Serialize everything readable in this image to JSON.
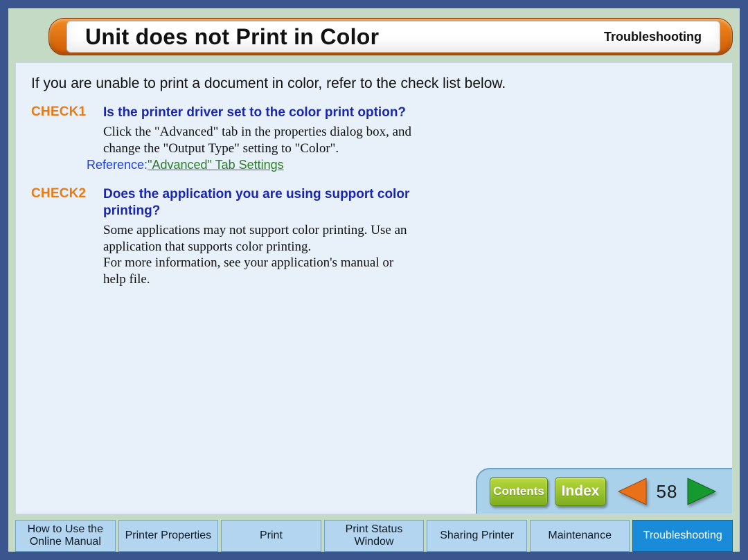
{
  "header": {
    "title": "Unit does not Print in Color",
    "section": "Troubleshooting"
  },
  "intro": "If you are unable to print a document in color, refer to the check list below.",
  "checks": [
    {
      "label": "CHECK1",
      "question": "Is the printer driver set to the color print option?",
      "body": "Click the \"Advanced\" tab in the properties dialog box, and change the \"Output Type\" setting to \"Color\".",
      "reference_label": "Reference:",
      "reference_link": "\"Advanced\" Tab Settings"
    },
    {
      "label": "CHECK2",
      "question": "Does the application you are using support color printing?",
      "body": "Some applications may not support color printing. Use an application that supports color printing.\nFor more information, see your application's manual or help file.",
      "reference_label": "",
      "reference_link": ""
    }
  ],
  "nav": {
    "contents": "Contents",
    "index": "Index",
    "page": "58"
  },
  "tabs": [
    "How to Use the Online Manual",
    "Printer Properties",
    "Print",
    "Print Status Window",
    "Sharing Printer",
    "Maintenance",
    "Troubleshooting"
  ],
  "active_tab": 6
}
